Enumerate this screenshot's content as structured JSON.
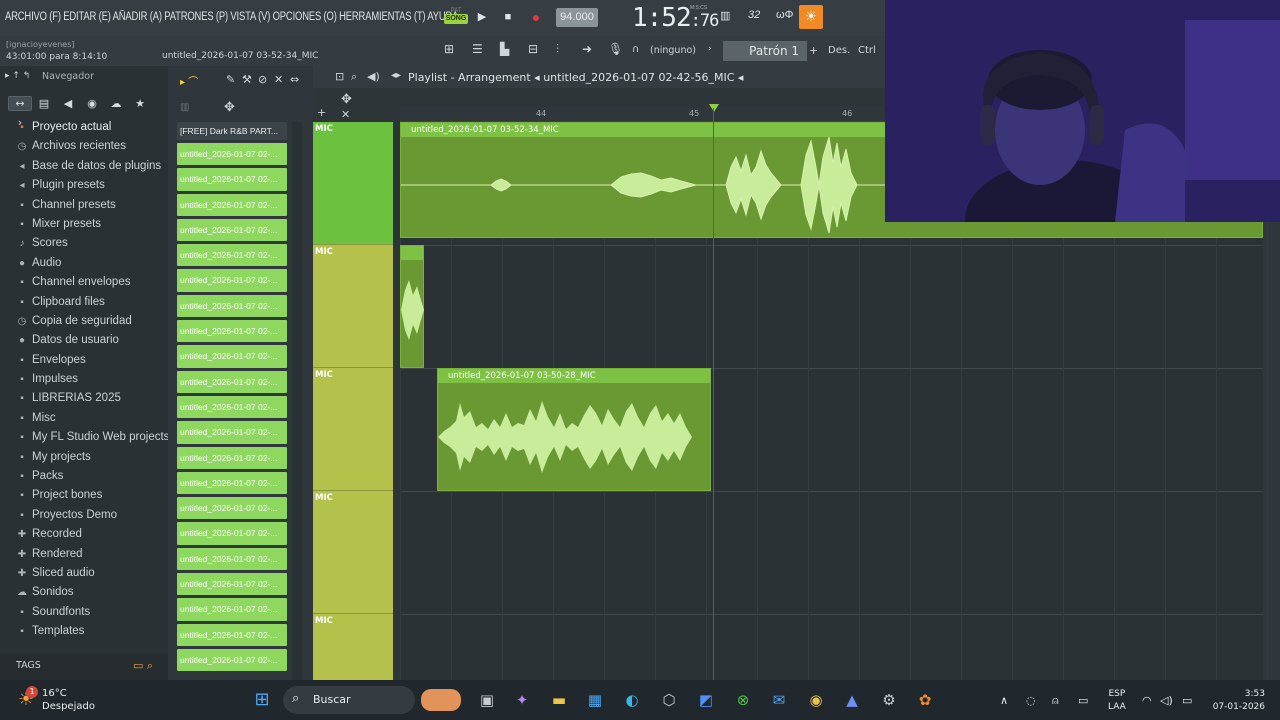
{
  "menubar": {
    "menu_text": "ARCHIVO (F) EDITAR (E) AÑADIR (A) PATRONES (P) VISTA (V) OPCIONES (O) HERRAMIENTAS (T) AYUDA",
    "pat_label": "PAT",
    "song_label": "SONG",
    "tempo": "94.000",
    "clock_main": "1:52",
    "clock_sub": ":76",
    "clock_unit": "M:S:CS",
    "cpu_label": "32",
    "cpu_icon": "cpu-bars-icon",
    "sun_icon": "sun-icon"
  },
  "toolbar2": {
    "user": "[ignacioyevenes]",
    "time_info": "43:01:00 para 8:14:10",
    "file_name": "untitled_2026-01-07 03-52-34_MIC",
    "ninguno": "(ninguno)",
    "patron": "Patrón 1",
    "des": "Des.",
    "ctrl": "Ctrl"
  },
  "browser": {
    "title": "Navegador",
    "items": [
      {
        "label": "Proyecto actual",
        "icon": "folder-icon"
      },
      {
        "label": "Archivos recientes",
        "icon": "clock-icon"
      },
      {
        "label": "Base de datos de plugins",
        "icon": "plug-icon"
      },
      {
        "label": "Plugin presets",
        "icon": "plug-icon"
      },
      {
        "label": "Channel presets",
        "icon": "folder-icon"
      },
      {
        "label": "Mixer presets",
        "icon": "folder-icon"
      },
      {
        "label": "Scores",
        "icon": "note-icon"
      },
      {
        "label": "Audio",
        "icon": "person-icon"
      },
      {
        "label": "Channel envelopes",
        "icon": "folder-icon"
      },
      {
        "label": "Clipboard files",
        "icon": "folder-icon"
      },
      {
        "label": "Copia de seguridad",
        "icon": "clock-icon"
      },
      {
        "label": "Datos de usuario",
        "icon": "person-icon"
      },
      {
        "label": "Envelopes",
        "icon": "folder-icon"
      },
      {
        "label": "Impulses",
        "icon": "folder-icon"
      },
      {
        "label": "LIBRERIAS 2025",
        "icon": "folder-icon"
      },
      {
        "label": "Misc",
        "icon": "folder-icon"
      },
      {
        "label": "My FL Studio Web projects",
        "icon": "folder-icon"
      },
      {
        "label": "My projects",
        "icon": "folder-icon"
      },
      {
        "label": "Packs",
        "icon": "folder-icon"
      },
      {
        "label": "Project bones",
        "icon": "folder-icon"
      },
      {
        "label": "Proyectos Demo",
        "icon": "folder-icon"
      },
      {
        "label": "Recorded",
        "icon": "plus-icon"
      },
      {
        "label": "Rendered",
        "icon": "plus-icon"
      },
      {
        "label": "Sliced audio",
        "icon": "plus-icon"
      },
      {
        "label": "Sonidos",
        "icon": "cloud-icon"
      },
      {
        "label": "Soundfonts",
        "icon": "folder-icon"
      },
      {
        "label": "Templates",
        "icon": "folder-icon"
      }
    ],
    "tags": "TAGS"
  },
  "channels": {
    "header": "[FREE] Dark R&B PART...",
    "items": [
      "untitled_2026-01-07 02-...",
      "untitled_2026-01-07 02-...",
      "untitled_2026-01-07 02-...",
      "untitled_2026-01-07 02-...",
      "untitled_2026-01-07 02-...",
      "untitled_2026-01-07 02-...",
      "untitled_2026-01-07 02-...",
      "untitled_2026-01-07 02-...",
      "untitled_2026-01-07 02-...",
      "untitled_2026-01-07 02-...",
      "untitled_2026-01-07 02-...",
      "untitled_2026-01-07 02-...",
      "untitled_2026-01-07 02-...",
      "untitled_2026-01-07 02-...",
      "untitled_2026-01-07 02-...",
      "untitled_2026-01-07 02-...",
      "untitled_2026-01-07 02-...",
      "untitled_2026-01-07 02-...",
      "untitled_2026-01-07 02-...",
      "untitled_2026-01-07 02-...",
      "untitled_2026-01-07 02-..."
    ]
  },
  "playlist": {
    "title": "Playlist - Arrangement",
    "breadcrumb": "untitled_2026-01-07 02-42-56_MIC",
    "ruler": [
      "44",
      "45",
      "46"
    ],
    "tracks": [
      "MIC",
      "MIC",
      "MIC",
      "MIC",
      "MIC"
    ],
    "clips": [
      {
        "name": "untitled_2026-01-07 03-52-34_MIC"
      },
      {
        "name": ""
      },
      {
        "name": "untitled_2026-01-07 03-50-28_MIC"
      }
    ]
  },
  "taskbar": {
    "weather_temp": "16°C",
    "weather_desc": "Despejado",
    "weather_badge": "1",
    "search": "Buscar",
    "lang1": "ESP",
    "lang2": "LAA",
    "time": "3:53",
    "date": "07-01-2026"
  },
  "colors": {
    "clip_green": "#7dc244",
    "track_yellow": "#b4c24c",
    "accent_orange": "#f08a25"
  }
}
